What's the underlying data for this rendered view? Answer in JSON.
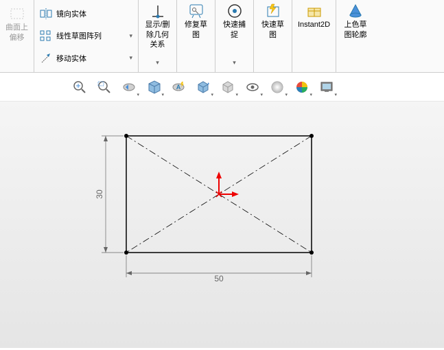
{
  "ribbon": {
    "offset": {
      "label_l1": "曲面上",
      "label_l2": "偏移"
    },
    "mirror": "镜向实体",
    "linear_pattern": "线性草图阵列",
    "move": "移动实体",
    "relations": {
      "l1": "显示/删",
      "l2": "除几何",
      "l3": "关系"
    },
    "repair": {
      "l1": "修复草",
      "l2": "图"
    },
    "quick_snap": {
      "l1": "快速捕",
      "l2": "捉"
    },
    "rapid_sketch": {
      "l1": "快速草",
      "l2": "图"
    },
    "instant2d": "Instant2D",
    "shaded": {
      "l1": "上色草",
      "l2": "图轮廓"
    }
  },
  "chart_data": {
    "type": "diagram",
    "shape": "rectangle",
    "width": 50,
    "height": 30,
    "dim_horizontal": "50",
    "dim_vertical": "30",
    "construction": [
      "diagonal1",
      "diagonal2"
    ],
    "origin": "center"
  }
}
